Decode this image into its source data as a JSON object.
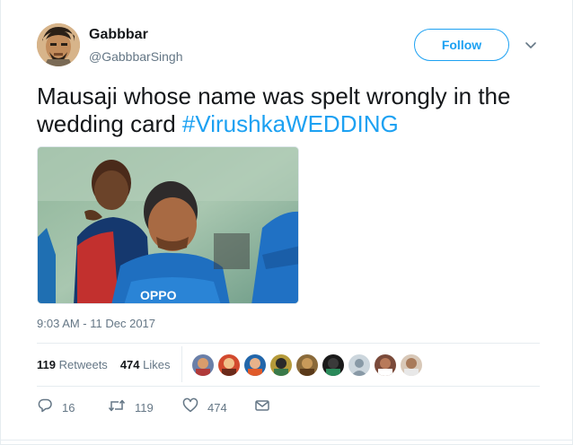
{
  "user": {
    "name": "Gabbbar",
    "handle": "@GabbbarSingh"
  },
  "follow_label": "Follow",
  "tweet": {
    "text_line": "Mausaji whose name was spelt wrongly in the wedding card",
    "hashtag": "#VirushkaWEDDING",
    "timestamp": "9:03 AM - 11 Dec 2017"
  },
  "stats": {
    "retweets_count": "119",
    "retweets_label": "Retweets",
    "likes_count": "474",
    "likes_label": "Likes"
  },
  "actions": {
    "replies": "16",
    "retweets": "119",
    "likes": "474"
  },
  "colors": {
    "accent": "#1da1f2",
    "secondary_text": "#657786",
    "border": "#e6ecf0"
  },
  "icons": [
    "chevron-down-icon",
    "reply-icon",
    "retweet-icon",
    "heart-icon",
    "envelope-icon"
  ]
}
